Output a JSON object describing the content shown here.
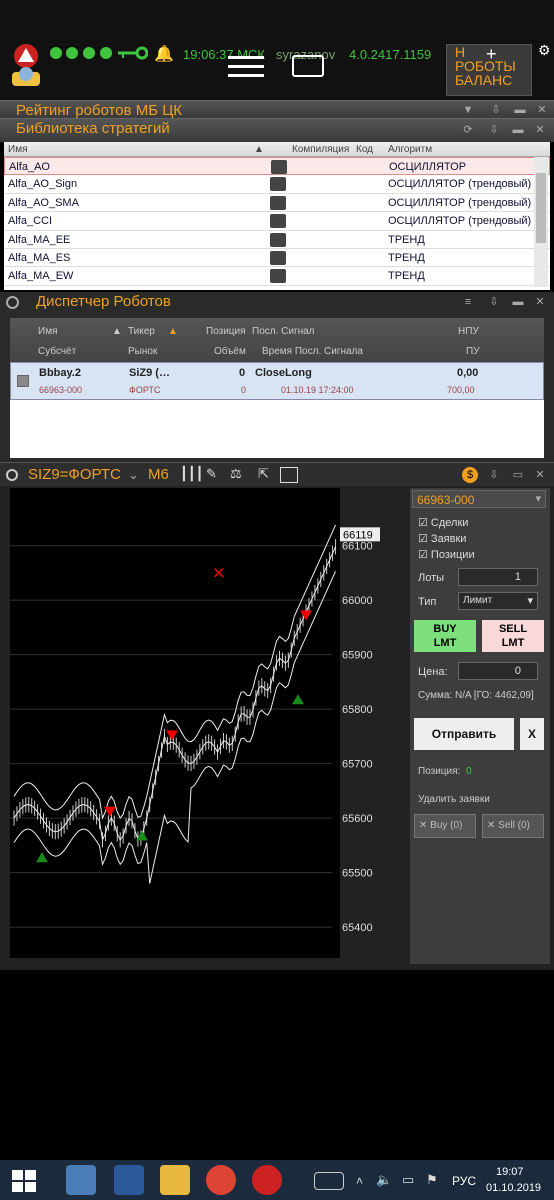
{
  "topbar": {
    "clock": "19:06:37 МСК",
    "user": "syrazanov",
    "version": "4.0.2417.1159",
    "right_btn_lines": [
      "Н",
      "РОБОТЫ",
      "БАЛАНС"
    ]
  },
  "panels": {
    "rating_title": "Рейтинг роботов МБ ЦК",
    "library_title": "Библиотека стратегий",
    "dispatcher_title": "Диспетчер Роботов"
  },
  "strategy_table": {
    "headers": {
      "name": "Имя",
      "compile": "Компиляция",
      "code": "Код",
      "algo": "Алгоритм"
    },
    "rows": [
      {
        "name": "Alfa_AO",
        "algo": "ОСЦИЛЛЯТОР"
      },
      {
        "name": "Alfa_AO_Sign",
        "algo": "ОСЦИЛЛЯТОР (трендовый)"
      },
      {
        "name": "Alfa_AO_SMA",
        "algo": "ОСЦИЛЛЯТОР (трендовый)"
      },
      {
        "name": "Alfa_CCI",
        "algo": "ОСЦИЛЛЯТОР (трендовый)"
      },
      {
        "name": "Alfa_MA_EE",
        "algo": "ТРЕНД"
      },
      {
        "name": "Alfa_MA_ES",
        "algo": "ТРЕНД"
      },
      {
        "name": "Alfa_MA_EW",
        "algo": "ТРЕНД"
      }
    ],
    "btn_label": "..."
  },
  "robot_table": {
    "headers": {
      "name": "Имя",
      "ticker": "Тикер",
      "position": "Позиция",
      "last_signal": "Посл. Сигнал",
      "npu": "НПУ",
      "subaccount": "Субсчёт",
      "market": "Рынок",
      "volume": "Объём",
      "last_signal_time": "Время Посл. Сигнала",
      "pu": "ПУ"
    },
    "row": {
      "name": "Bbbay.2",
      "ticker": "SiZ9 (…",
      "position": "0",
      "last_signal": "CloseLong",
      "npu": "0,00",
      "subaccount": "66963-000",
      "market": "ФОРТС",
      "volume": "0",
      "last_signal_time": "01.10.19 17:24:00",
      "pu": "700,00"
    }
  },
  "chart_window": {
    "title": "SIZ9=ФОРТС",
    "timeframe": "M6"
  },
  "chart_data": {
    "type": "candlestick",
    "price_labels": [
      "66100",
      "66000",
      "65900",
      "65800",
      "65700",
      "65600",
      "65500",
      "65400"
    ],
    "last_price": "66119",
    "ylim": [
      65380,
      66160
    ]
  },
  "side_panel": {
    "account": "66963-000",
    "chk_deals": "Сделки",
    "chk_orders": "Заявки",
    "chk_positions": "Позиции",
    "lots_label": "Лоты",
    "lots_value": "1",
    "type_label": "Тип",
    "type_value": "Лимит",
    "buy_line1": "BUY",
    "buy_line2": "LMT",
    "sell_line1": "SELL",
    "sell_line2": "LMT",
    "price_label": "Цена:",
    "price_value": "0",
    "sum_text": "Сумма: N/A [ГО: 4462,09]",
    "send_label": "Отправить",
    "close_label": "X",
    "position_label": "Позиция:",
    "position_value": "0",
    "delete_orders": "Удалить заявки",
    "buy_count": "Buy (0)",
    "sell_count": "Sell (0)"
  },
  "taskbar": {
    "lang": "РУС",
    "time": "19:07",
    "date": "01.10.2019"
  }
}
